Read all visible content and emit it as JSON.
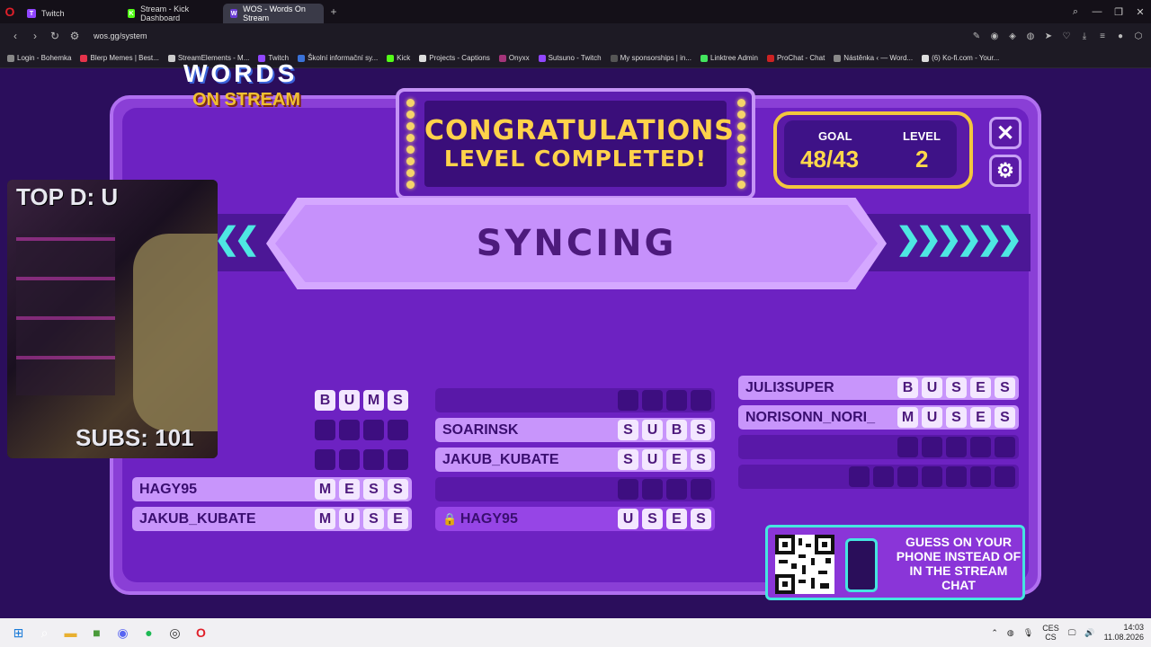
{
  "browser": {
    "tabs": [
      {
        "label": "Twitch",
        "color": "#9146ff",
        "glyph": "T",
        "active": false
      },
      {
        "label": "Stream - Kick Dashboard",
        "color": "#53fc18",
        "glyph": "K",
        "active": false
      },
      {
        "label": "WOS - Words On Stream",
        "color": "#6a3bd6",
        "glyph": "W",
        "active": true
      }
    ],
    "url": "wos.gg/system",
    "bookmarks": [
      {
        "label": "Login - Bohemka",
        "color": "#888"
      },
      {
        "label": "Blerp Memes | Best...",
        "color": "#e5334b"
      },
      {
        "label": "StreamElements - M...",
        "color": "#ccc"
      },
      {
        "label": "Twitch",
        "color": "#9146ff"
      },
      {
        "label": "Školní informační sy...",
        "color": "#3a72d8"
      },
      {
        "label": "Kick",
        "color": "#53fc18"
      },
      {
        "label": "Projects - Captions",
        "color": "#ddd"
      },
      {
        "label": "Onyxx",
        "color": "#a4347a"
      },
      {
        "label": "Sutsuno - Twitch",
        "color": "#9146ff"
      },
      {
        "label": "My sponsorships | in...",
        "color": "#555"
      },
      {
        "label": "Linktree Admin",
        "color": "#43e55e"
      },
      {
        "label": "ProChat - Chat",
        "color": "#c22"
      },
      {
        "label": "Nástěnka ‹ — Word...",
        "color": "#888"
      },
      {
        "label": "(6) Ko-fi.com - Your...",
        "color": "#ddd"
      }
    ]
  },
  "game": {
    "logo_words": "WORDS",
    "logo_on_stream": "ON STREAM",
    "congrats_line1": "CONGRATULATIONS",
    "congrats_line2": "LEVEL COMPLETED!",
    "goal_label": "GOAL",
    "goal_value": "48/43",
    "level_label": "LEVEL",
    "level_value": "2",
    "status": "SYNCING",
    "webcam_top": "TOP D: U",
    "webcam_subs": "SUBS: 101",
    "qr_text": "GUESS ON YOUR PHONE INSTEAD OF IN THE STREAM CHAT",
    "columns": [
      [
        {
          "name": "",
          "letters": [
            "B",
            "U",
            "M",
            "S"
          ],
          "state": "filled"
        },
        {
          "name": "",
          "letters": [
            "",
            "",
            "",
            ""
          ],
          "state": "empty"
        },
        {
          "name": "",
          "letters": [
            "",
            "",
            "",
            ""
          ],
          "state": "empty"
        },
        {
          "name": "HAGY95",
          "letters": [
            "M",
            "E",
            "S",
            "S"
          ],
          "state": "filled"
        },
        {
          "name": "JAKUB_KUBATE",
          "letters": [
            "M",
            "U",
            "S",
            "E"
          ],
          "state": "filled"
        }
      ],
      [
        {
          "name": "",
          "letters": [
            "",
            "",
            "",
            ""
          ],
          "state": "empty"
        },
        {
          "name": "SOARINSK",
          "letters": [
            "S",
            "U",
            "B",
            "S"
          ],
          "state": "filled"
        },
        {
          "name": "JAKUB_KUBATE",
          "letters": [
            "S",
            "U",
            "E",
            "S"
          ],
          "state": "filled"
        },
        {
          "name": "",
          "letters": [
            "",
            "",
            "",
            ""
          ],
          "state": "empty"
        },
        {
          "name": "HAGY95",
          "letters": [
            "U",
            "S",
            "E",
            "S"
          ],
          "state": "lock"
        }
      ],
      [
        {
          "name": "JULI3SUPER",
          "letters": [
            "B",
            "U",
            "S",
            "E",
            "S"
          ],
          "state": "filled"
        },
        {
          "name": "NORISONN_NORI_",
          "letters": [
            "M",
            "U",
            "S",
            "E",
            "S"
          ],
          "state": "filled"
        },
        {
          "name": "",
          "letters": [
            "",
            "",
            "",
            "",
            ""
          ],
          "state": "empty"
        },
        {
          "name": "",
          "letters": [
            "",
            "",
            "",
            "",
            "",
            "",
            ""
          ],
          "state": "empty"
        }
      ]
    ]
  },
  "taskbar": {
    "lang": "CES",
    "lang2": "CS",
    "time": "14:03",
    "date": "11.08.2026"
  }
}
